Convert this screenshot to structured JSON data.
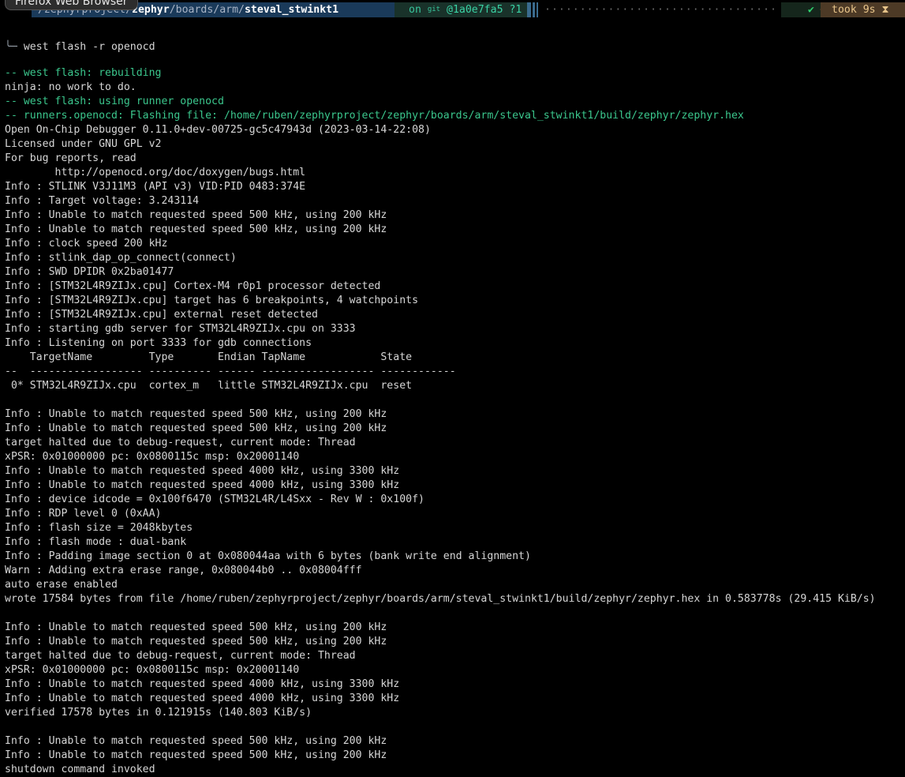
{
  "tooltip": "Firefox Web Browser",
  "prompt": {
    "path_prefix": "~/zephyrproject/",
    "path_zephyr": "zephyr",
    "path_sep1": "/boards/arm/",
    "path_last": "steval_stwinkt1",
    "git_on": "on ",
    "git_icon": "git",
    "git_hash": "@1a0e7fa5 ?1",
    "dots": "·····································································",
    "status_ok": "✔",
    "took_label": "took 9s ⧗",
    "colors": {
      "path_bg": "#1a3a5a",
      "git_fg": "#38c59b",
      "ok": "#2fd36f",
      "took_bg": "#4d3a26"
    }
  },
  "command": {
    "corner": "╰─",
    "text": " west flash -r openocd"
  },
  "output": {
    "lines": [
      {
        "text": "-- west flash: rebuilding",
        "style": "green"
      },
      {
        "text": "ninja: no work to do.",
        "style": "normal"
      },
      {
        "text": "-- west flash: using runner openocd",
        "style": "green"
      },
      {
        "text": "-- runners.openocd: Flashing file: /home/ruben/zephyrproject/zephyr/boards/arm/steval_stwinkt1/build/zephyr/zephyr.hex",
        "style": "green"
      },
      {
        "text": "Open On-Chip Debugger 0.11.0+dev-00725-gc5c47943d (2023-03-14-22:08)",
        "style": "normal"
      },
      {
        "text": "Licensed under GNU GPL v2",
        "style": "normal"
      },
      {
        "text": "For bug reports, read",
        "style": "normal"
      },
      {
        "text": "        http://openocd.org/doc/doxygen/bugs.html",
        "style": "normal"
      },
      {
        "text": "Info : STLINK V3J11M3 (API v3) VID:PID 0483:374E",
        "style": "normal"
      },
      {
        "text": "Info : Target voltage: 3.243114",
        "style": "normal"
      },
      {
        "text": "Info : Unable to match requested speed 500 kHz, using 200 kHz",
        "style": "normal"
      },
      {
        "text": "Info : Unable to match requested speed 500 kHz, using 200 kHz",
        "style": "normal"
      },
      {
        "text": "Info : clock speed 200 kHz",
        "style": "normal"
      },
      {
        "text": "Info : stlink_dap_op_connect(connect)",
        "style": "normal"
      },
      {
        "text": "Info : SWD DPIDR 0x2ba01477",
        "style": "normal"
      },
      {
        "text": "Info : [STM32L4R9ZIJx.cpu] Cortex-M4 r0p1 processor detected",
        "style": "normal"
      },
      {
        "text": "Info : [STM32L4R9ZIJx.cpu] target has 6 breakpoints, 4 watchpoints",
        "style": "normal"
      },
      {
        "text": "Info : [STM32L4R9ZIJx.cpu] external reset detected",
        "style": "normal"
      },
      {
        "text": "Info : starting gdb server for STM32L4R9ZIJx.cpu on 3333",
        "style": "normal"
      },
      {
        "text": "Info : Listening on port 3333 for gdb connections",
        "style": "normal"
      },
      {
        "text": "    TargetName         Type       Endian TapName            State",
        "style": "normal"
      },
      {
        "text": "--  ------------------ ---------- ------ ------------------ ------------",
        "style": "normal"
      },
      {
        "text": " 0* STM32L4R9ZIJx.cpu  cortex_m   little STM32L4R9ZIJx.cpu  reset",
        "style": "normal"
      },
      {
        "text": "",
        "style": "normal"
      },
      {
        "text": "Info : Unable to match requested speed 500 kHz, using 200 kHz",
        "style": "normal"
      },
      {
        "text": "Info : Unable to match requested speed 500 kHz, using 200 kHz",
        "style": "normal"
      },
      {
        "text": "target halted due to debug-request, current mode: Thread",
        "style": "normal"
      },
      {
        "text": "xPSR: 0x01000000 pc: 0x0800115c msp: 0x20001140",
        "style": "normal"
      },
      {
        "text": "Info : Unable to match requested speed 4000 kHz, using 3300 kHz",
        "style": "normal"
      },
      {
        "text": "Info : Unable to match requested speed 4000 kHz, using 3300 kHz",
        "style": "normal"
      },
      {
        "text": "Info : device idcode = 0x100f6470 (STM32L4R/L4Sxx - Rev W : 0x100f)",
        "style": "normal"
      },
      {
        "text": "Info : RDP level 0 (0xAA)",
        "style": "normal"
      },
      {
        "text": "Info : flash size = 2048kbytes",
        "style": "normal"
      },
      {
        "text": "Info : flash mode : dual-bank",
        "style": "normal"
      },
      {
        "text": "Info : Padding image section 0 at 0x080044aa with 6 bytes (bank write end alignment)",
        "style": "normal"
      },
      {
        "text": "Warn : Adding extra erase range, 0x080044b0 .. 0x08004fff",
        "style": "normal"
      },
      {
        "text": "auto erase enabled",
        "style": "normal"
      },
      {
        "text": "wrote 17584 bytes from file /home/ruben/zephyrproject/zephyr/boards/arm/steval_stwinkt1/build/zephyr/zephyr.hex in 0.583778s (29.415 KiB/s)",
        "style": "normal"
      },
      {
        "text": "",
        "style": "normal"
      },
      {
        "text": "Info : Unable to match requested speed 500 kHz, using 200 kHz",
        "style": "normal"
      },
      {
        "text": "Info : Unable to match requested speed 500 kHz, using 200 kHz",
        "style": "normal"
      },
      {
        "text": "target halted due to debug-request, current mode: Thread",
        "style": "normal"
      },
      {
        "text": "xPSR: 0x01000000 pc: 0x0800115c msp: 0x20001140",
        "style": "normal"
      },
      {
        "text": "Info : Unable to match requested speed 4000 kHz, using 3300 kHz",
        "style": "normal"
      },
      {
        "text": "Info : Unable to match requested speed 4000 kHz, using 3300 kHz",
        "style": "normal"
      },
      {
        "text": "verified 17578 bytes in 0.121915s (140.803 KiB/s)",
        "style": "normal"
      },
      {
        "text": "",
        "style": "normal"
      },
      {
        "text": "Info : Unable to match requested speed 500 kHz, using 200 kHz",
        "style": "normal"
      },
      {
        "text": "Info : Unable to match requested speed 500 kHz, using 200 kHz",
        "style": "normal"
      },
      {
        "text": "shutdown command invoked",
        "style": "normal"
      }
    ]
  }
}
